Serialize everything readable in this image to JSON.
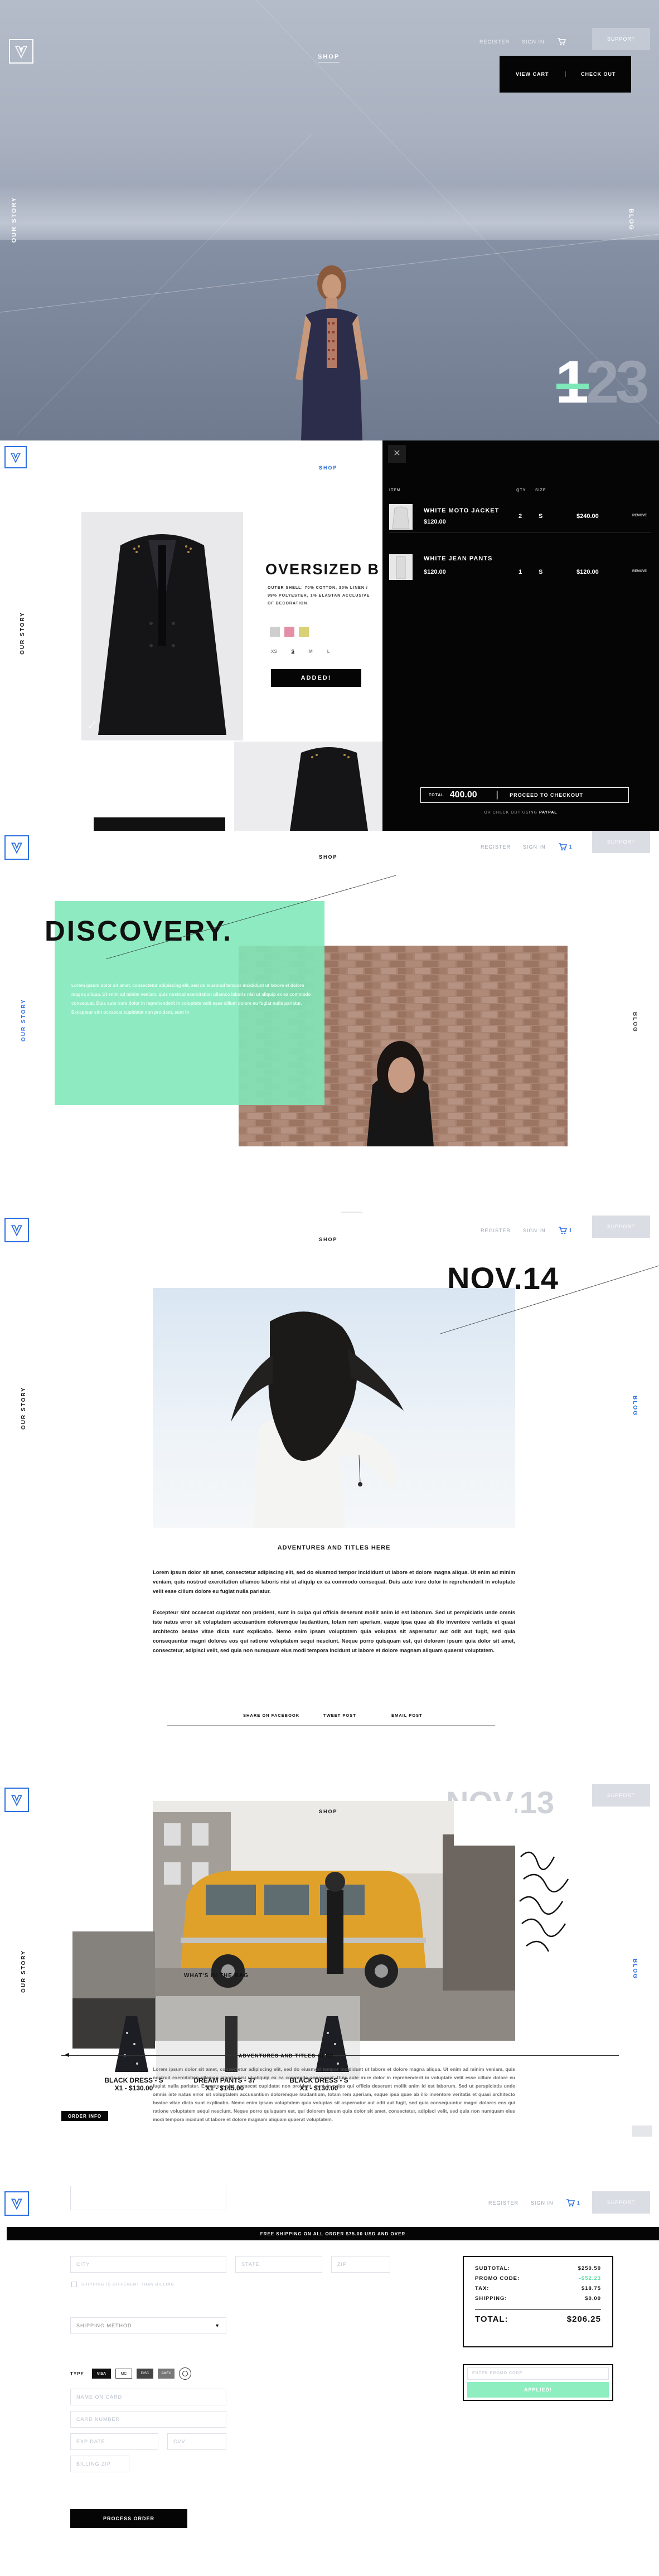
{
  "header": {
    "register": "REGISTER",
    "sign_in": "SIGN IN",
    "cart_count": "1",
    "support": "SUPPORT",
    "shop": "SHOP",
    "our_story": "OUR STORY",
    "blog": "BLOG"
  },
  "hero": {
    "dropdown": {
      "view_cart": "VIEW CART",
      "check_out": "CHECK OUT"
    },
    "counter_active": "1",
    "counter_rest": "23"
  },
  "product": {
    "title": "OVERSIZED B",
    "description": "OUTER SHELL: 70% COTTON, 30% LINEN / 99% POLYESTER, 1% ELASTAN ACCLUSIVE OF DECORATION.",
    "colors": [
      "#cfcfcf",
      "#e58fa7",
      "#d8d176"
    ],
    "sizes": [
      "XS",
      "S",
      "M",
      "L"
    ],
    "selected_size": "S",
    "added_label": "ADDED!"
  },
  "cart": {
    "col_item": "ITEM",
    "col_qty": "QTY",
    "col_size": "SIZE",
    "remove": "REMOVE",
    "items": [
      {
        "name": "WHITE MOTO JACKET",
        "price": "$120.00",
        "qty": "2",
        "size": "S",
        "total": "$240.00"
      },
      {
        "name": "WHITE JEAN PANTS",
        "price": "$120.00",
        "qty": "1",
        "size": "S",
        "total": "$120.00"
      }
    ],
    "total_label": "TOTAL",
    "total_value": "400.00",
    "proceed": "PROCEED TO CHECKOUT",
    "or_paypal_prefix": "OR CHECK OUT USING",
    "paypal": "PAYPAL"
  },
  "discovery": {
    "title": "DISCOVERY.",
    "paragraph": "Lorem ipsum dolor sit amet, consectetur adipiscing elit, sed do eiusmod tempor incididunt ut labore et dolore magna aliqua. Ut enim ad minim veniam, quis nostrud exercitation ullamco laboris nisi ut aliquip ex ea commodo consequat. Duis aute irure dolor in reprehenderit in voluptate velit esse cillum dolore eu fugiat nulla pariatur. Excepteur sint occaecat cupidatat non proident, sunt in"
  },
  "article": {
    "date": "NOV.14",
    "title": "ADVENTURES AND TITLES HERE",
    "p1": "Lorem ipsum dolor sit amet, consectetur adipiscing elit, sed do eiusmod tempor incididunt ut labore et dolore magna aliqua. Ut enim ad minim veniam, quis nostrud exercitation ullamco laboris nisi ut aliquip ex ea commodo consequat. Duis aute irure dolor in reprehenderit in voluptate velit esse cillum dolore eu fugiat nulla pariatur.",
    "p2": "Excepteur sint occaecat cupidatat non proident, sunt in culpa qui officia deserunt mollit anim id est laborum. Sed ut perspiciatis unde omnis iste natus error sit voluptatem accusantium doloremque laudantium, totam rem aperiam, eaque ipsa quae ab illo inventore veritatis et quasi architecto beatae vitae dicta sunt explicabo. Nemo enim ipsam voluptatem quia voluptas sit aspernatur aut odit aut fugit, sed quia consequuntur magni dolores eos qui ratione voluptatem sequi nesciunt. Neque porro quisquam est, qui dolorem ipsum quia dolor sit amet, consectetur, adipisci velit, sed quia non numquam eius modi tempora incidunt ut labore et dolore magnam aliquam quaerat voluptatem.",
    "share_facebook": "SHARE ON FACEBOOK",
    "tweet": "TWEET POST",
    "email": "EMAIL POST"
  },
  "collage": {
    "date": "NOV.13",
    "whats_title": "WHAT'S IN THE BAG",
    "adv_title": "ADVENTURES AND TITLES HERE",
    "products": [
      {
        "name": "BLACK DRESS - S",
        "price": "X1 - $130.00"
      },
      {
        "name": "DREAM PANTS - 37",
        "price": "X1 - $145.00"
      },
      {
        "name": "BLACK DRESS - S",
        "price": "X1 - $130.00"
      }
    ],
    "order_info": "ORDER INFO",
    "text": "Lorem ipsum dolor sit amet, consectetur adipiscing elit, sed do eiusmod tempor incididunt ut labore et dolore magna aliqua. Ut enim ad minim veniam, quis nostrud exercitation ullamco laboris nisi ut aliquip ex ea commodo consequat. Duis aute irure dolor in reprehenderit in voluptate velit esse cillum dolore eu fugiat nulla pariatur. Excepteur sint occaecat cupidatat non proident, sunt in culpa qui officia deserunt mollit anim id est laborum. Sed ut perspiciatis unde omnis iste natus error sit voluptatem accusantium doloremque laudantium, totam rem aperiam, eaque ipsa quae ab illo inventore veritatis et quasi architecto beatae vitae dicta sunt explicabo. Nemo enim ipsam voluptatem quia voluptas sit aspernatur aut odit aut fugit, sed quia consequuntur magni dolores eos qui ratione voluptatem sequi nesciunt. Neque porro quisquam est, qui dolorem ipsum quia dolor sit amet, consectetur, adipisci velit, sed quia non numquam eius modi tempora incidunt ut labore et dolore magnam aliquam quaerat voluptatem."
  },
  "checkout": {
    "banner": "FREE SHIPPING ON ALL ORDER $75.00 USD AND OVER",
    "fields": {
      "city": "CITY",
      "state": "STATE",
      "zip": "ZIP",
      "shipping_method": "SHIPPING METHOD",
      "name_on_card": "NAME ON CARD",
      "card_number": "CARD NUMBER",
      "exp_date": "EXP DATE",
      "cvv": "CVV",
      "billing_zip": "BILLING ZIP"
    },
    "shipping_same": "SHIPPING IS DIFFERENT THAN BILLING",
    "type_label": "TYPE",
    "card_types": [
      "VISA",
      "MC",
      "DISC",
      "AMEX"
    ],
    "process": "PROCESS ORDER",
    "summary": {
      "subtotal_label": "SUBTOTAL:",
      "subtotal": "$250.50",
      "promo_label": "PROMO CODE:",
      "promo": "-$52.23",
      "tax_label": "TAX:",
      "tax": "$18.75",
      "shipping_label": "SHIPPING:",
      "shipping": "$0.00",
      "total_label": "TOTAL:",
      "total": "$206.25"
    },
    "promo_placeholder": "ENTER PROMO CODE",
    "apply": "APPLIED!"
  },
  "colors": {
    "accent_blue": "#2d6fe0",
    "mint": "#7ee8b8",
    "black": "#050505"
  }
}
